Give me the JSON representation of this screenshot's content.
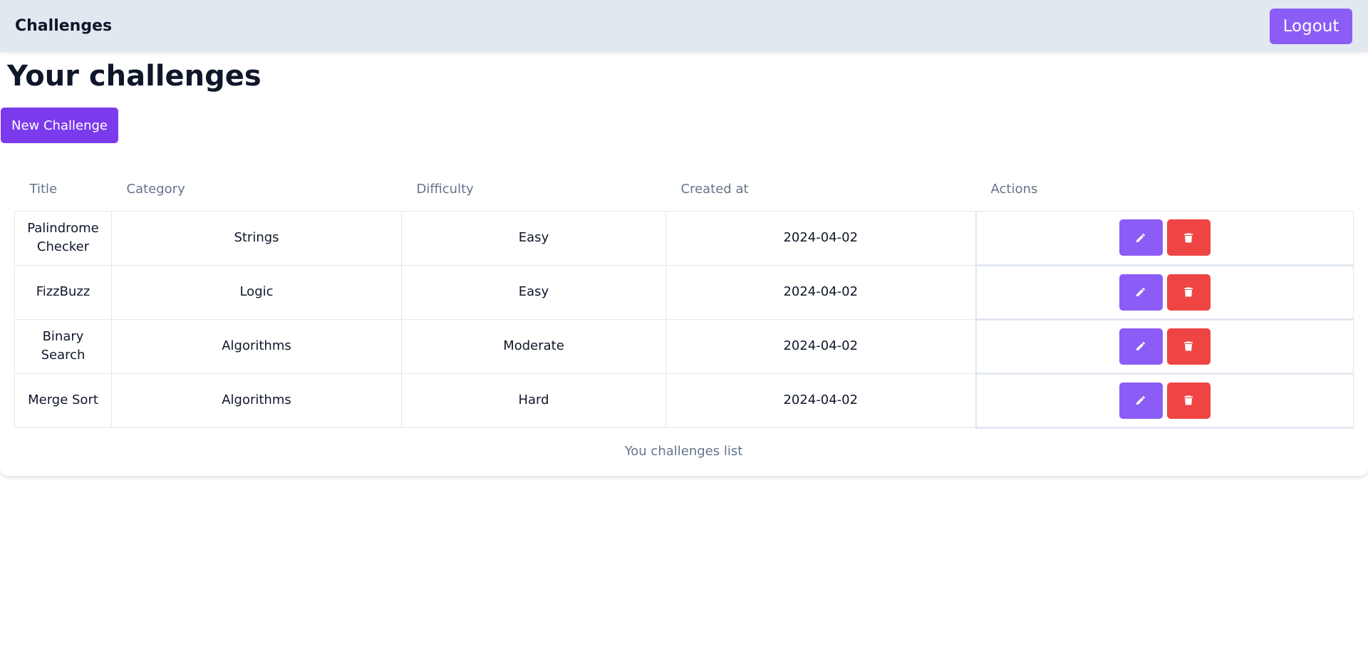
{
  "header": {
    "app_title": "Challenges",
    "logout_label": "Logout"
  },
  "page": {
    "title": "Your challenges",
    "new_button_label": "New Challenge"
  },
  "table": {
    "columns": [
      "Title",
      "Category",
      "Difficulty",
      "Created at",
      "Actions"
    ],
    "rows": [
      {
        "title": "Palindrome Checker",
        "category": "Strings",
        "difficulty": "Easy",
        "created_at": "2024-04-02"
      },
      {
        "title": "FizzBuzz",
        "category": "Logic",
        "difficulty": "Easy",
        "created_at": "2024-04-02"
      },
      {
        "title": "Binary Search",
        "category": "Algorithms",
        "difficulty": "Moderate",
        "created_at": "2024-04-02"
      },
      {
        "title": "Merge Sort",
        "category": "Algorithms",
        "difficulty": "Hard",
        "created_at": "2024-04-02"
      }
    ],
    "row_actions": {
      "edit_icon": "pencil-icon",
      "delete_icon": "trash-icon"
    },
    "caption": "You challenges list"
  },
  "colors": {
    "header_bg": "#e2e8f0",
    "accent": "#8b5cf6",
    "primary_button": "#7c3aed",
    "danger": "#ef4444",
    "muted_text": "#64748b",
    "text": "#0f172a",
    "border": "#e2e8f0"
  }
}
